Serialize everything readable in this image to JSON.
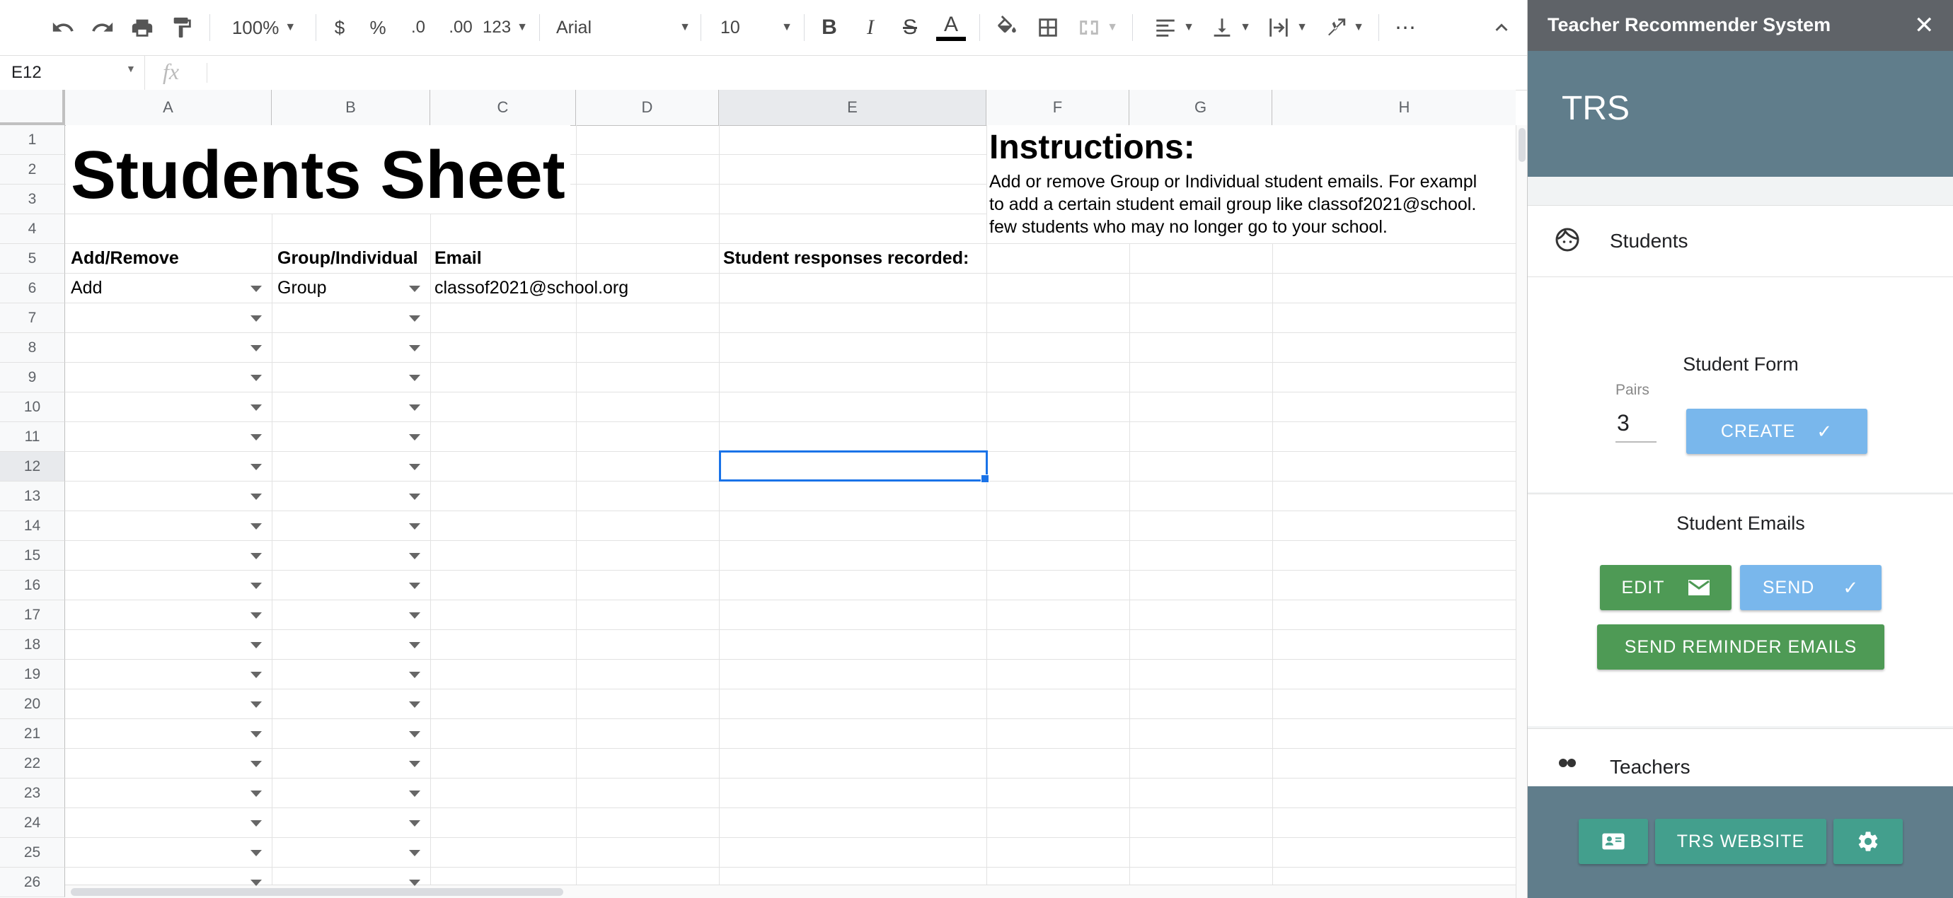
{
  "toolbar": {
    "zoom": "100%",
    "currency": "$",
    "percent": "%",
    "dec_decrease": ".0",
    "dec_increase": ".00",
    "more_formats": "123",
    "font": "Arial",
    "font_size": "10"
  },
  "formula_bar": {
    "cell_ref": "E12",
    "fx": "fx"
  },
  "columns": [
    "A",
    "B",
    "C",
    "D",
    "E",
    "F",
    "G",
    "H"
  ],
  "rows": [
    "1",
    "2",
    "3",
    "4",
    "5",
    "6",
    "7",
    "8",
    "9",
    "10",
    "11",
    "12",
    "13",
    "14",
    "15",
    "16",
    "17",
    "18",
    "19",
    "20",
    "21",
    "22",
    "23",
    "24",
    "25",
    "26"
  ],
  "sheet": {
    "title": "Students Sheet",
    "instructions_title": "Instructions:",
    "instructions_line1": "Add or remove Group or Individual student emails. For exampl",
    "instructions_line2": "to add a certain student email group like classof2021@school.",
    "instructions_line3": "few students who may no longer go to your school.",
    "header_add_remove": "Add/Remove",
    "header_group": "Group/Individual",
    "header_email": "Email",
    "header_responses": "Student responses recorded:",
    "row6_action": "Add",
    "row6_type": "Group",
    "row6_email": "classof2021@school.org"
  },
  "sidebar": {
    "window_title": "Teacher Recommender System",
    "close": "✕",
    "app_name": "TRS",
    "students_label": "Students",
    "student_form_title": "Student Form",
    "pairs_label": "Pairs",
    "pairs_value": "3",
    "create_label": "CREATE",
    "student_emails_title": "Student Emails",
    "edit_label": "EDIT",
    "send_label": "SEND",
    "reminder_label": "SEND REMINDER EMAILS",
    "next_section_partial": "Teachers",
    "website_label": "TRS WEBSITE"
  },
  "colors": {
    "header": "#607d8b",
    "green": "#4e9a55",
    "blue": "#79b7ec",
    "teal": "#439f8d"
  }
}
